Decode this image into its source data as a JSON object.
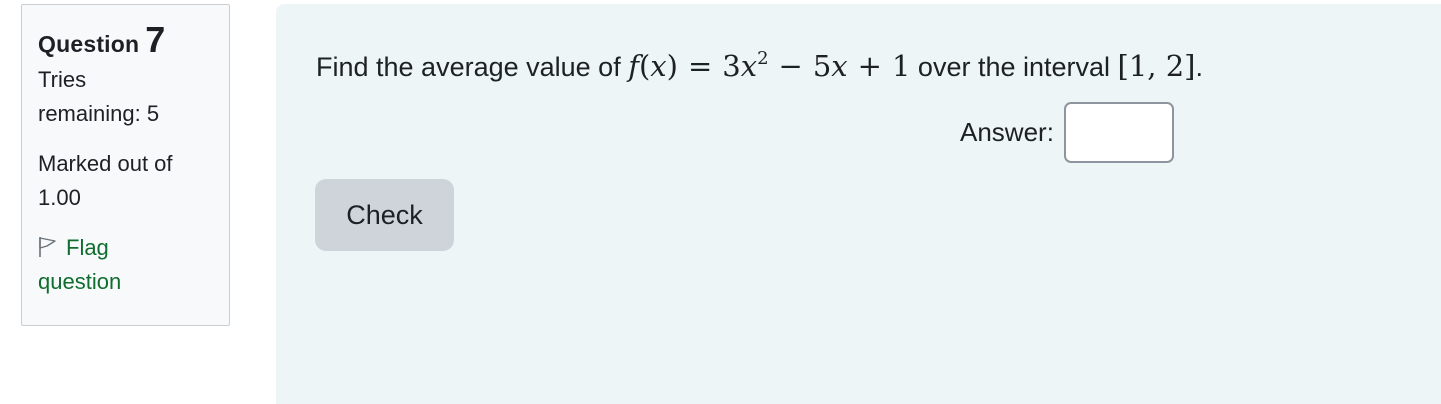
{
  "info": {
    "question_word": "Question",
    "question_number": "7",
    "tries_label": "Tries",
    "tries_remaining": "remaining: 5",
    "marked_label": "Marked out of",
    "marked_value": "1.00",
    "flag_line1": "Flag",
    "flag_line2": "question",
    "flag_icon": "flag-icon"
  },
  "question": {
    "prefix": "Find the average value of ",
    "func_f": "f",
    "func_open": "(",
    "func_x": "x",
    "func_close": ")",
    "eq": "=",
    "coef1": "3",
    "var1": "x",
    "power": "2",
    "minus": "−",
    "coef2": "5",
    "var2": "x",
    "plus": "+",
    "const": "1",
    "middle": " over the interval ",
    "interval": "[1, 2]",
    "suffix": "."
  },
  "answer": {
    "label": "Answer:",
    "value": ""
  },
  "check_label": "Check",
  "colors": {
    "flag_green": "#0f6e2f",
    "panel_bg": "#eef5f6",
    "button_bg": "#ced4da"
  }
}
